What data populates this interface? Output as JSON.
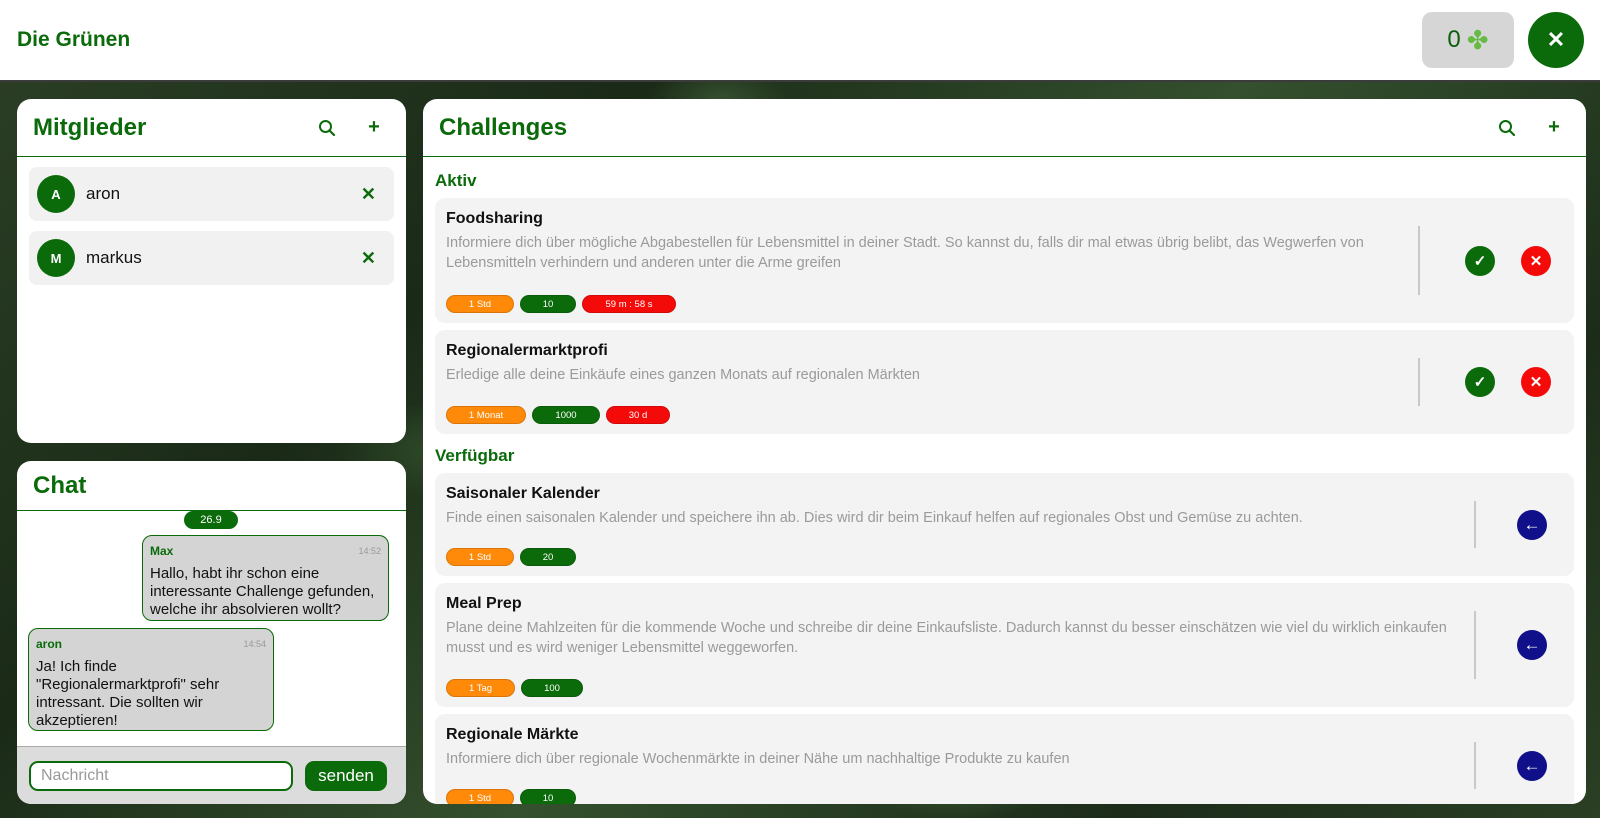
{
  "header": {
    "brand": "Die Grünen",
    "score": "0",
    "score_icon": "clover-icon",
    "close_icon": "close-icon"
  },
  "members": {
    "title": "Mitglieder",
    "items": [
      {
        "initial": "A",
        "name": "aron"
      },
      {
        "initial": "M",
        "name": "markus"
      }
    ]
  },
  "chat": {
    "title": "Chat",
    "date": "26.9",
    "messages": [
      {
        "author": "Max",
        "time": "14:52",
        "text": "Hallo, habt ihr schon eine interessante Challenge gefunden, welche ihr absolvieren wollt?"
      },
      {
        "author": "aron",
        "time": "14:54",
        "text": "Ja! Ich finde \"Regionalermarktprofi\" sehr intressant. Die sollten wir akzeptieren!"
      }
    ],
    "input_placeholder": "Nachricht",
    "input_value": "",
    "send_label": "senden"
  },
  "challenges": {
    "title": "Challenges",
    "active_title": "Aktiv",
    "available_title": "Verfügbar",
    "active": [
      {
        "title": "Foodsharing",
        "description": "Informiere dich über mögliche Abgabestellen für Lebensmittel in deiner Stadt. So kannst du, falls dir mal etwas übrig belibt, das Wegwerfen von Lebensmitteln verhindern und anderen unter die Arme greifen",
        "duration": "1 Std",
        "points": "10",
        "remaining": "59 m : 58 s"
      },
      {
        "title": "Regionalermarktprofi",
        "description": "Erledige alle deine Einkäufe eines ganzen Monats auf regionalen Märkten",
        "duration": "1 Monat",
        "points": "1000",
        "remaining": "30 d"
      }
    ],
    "available": [
      {
        "title": "Saisonaler Kalender",
        "description": "Finde einen saisonalen Kalender und speichere ihn ab. Dies wird dir beim Einkauf helfen auf regionales Obst und Gemüse zu achten.",
        "duration": "1 Std",
        "points": "20"
      },
      {
        "title": "Meal Prep",
        "description": "Plane deine Mahlzeiten für die kommende Woche und schreibe dir deine Einkaufsliste. Dadurch kannst du besser einschätzen wie viel du wirklich einkaufen musst und es wird weniger Lebensmittel weggeworfen.",
        "duration": "1 Tag",
        "points": "100"
      },
      {
        "title": "Regionale Märkte",
        "description": "Informiere dich über regionale Wochenmärkte in deiner Nähe um nachhaltige Produkte zu kaufen",
        "duration": "1 Std",
        "points": "10"
      }
    ]
  },
  "colors": {
    "brand": "#0b6b0b",
    "duration_tag": "#ff8a0a",
    "remaining_tag": "#f50a0a",
    "join_button": "#10108a"
  }
}
